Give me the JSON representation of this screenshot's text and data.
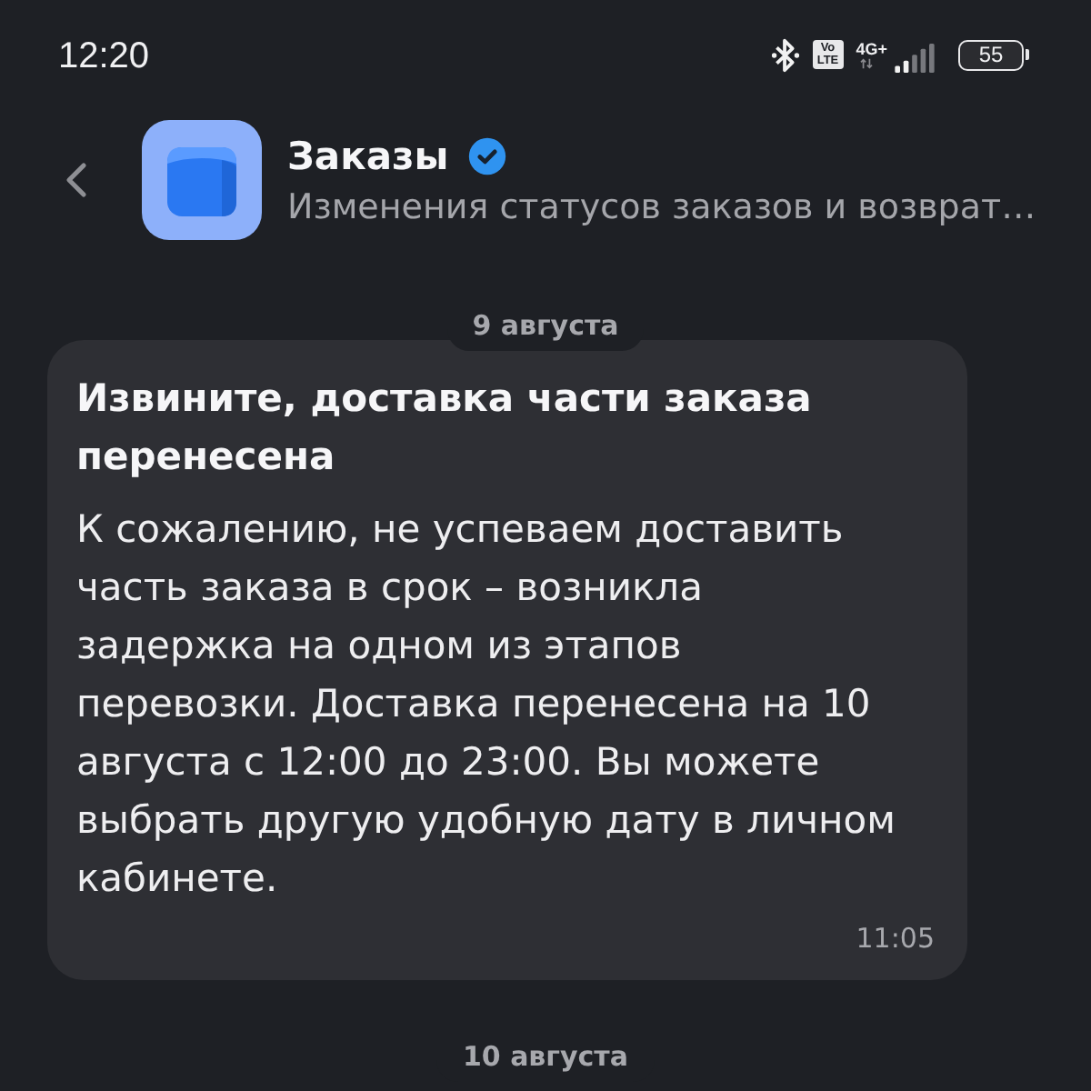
{
  "status_bar": {
    "time": "12:20",
    "volte": [
      "Vo",
      "LTE"
    ],
    "network": "4G+",
    "battery": "55"
  },
  "header": {
    "title": "Заказы",
    "verified": true,
    "subtitle": "Изменения статусов заказов и возврат…"
  },
  "messages": [
    {
      "date": "9 августа",
      "title": "Извините, доставка части заказа перенесена",
      "body": "К сожалению, не успеваем доставить часть заказа в срок – возникла задержка на одном из этапов перевозки. Доставка перенесена на 10 августа с 12:00 до 23:00. Вы можете выбрать другую удобную дату в личном кабинете.",
      "time": "11:05"
    }
  ],
  "next_date": "10 августа"
}
